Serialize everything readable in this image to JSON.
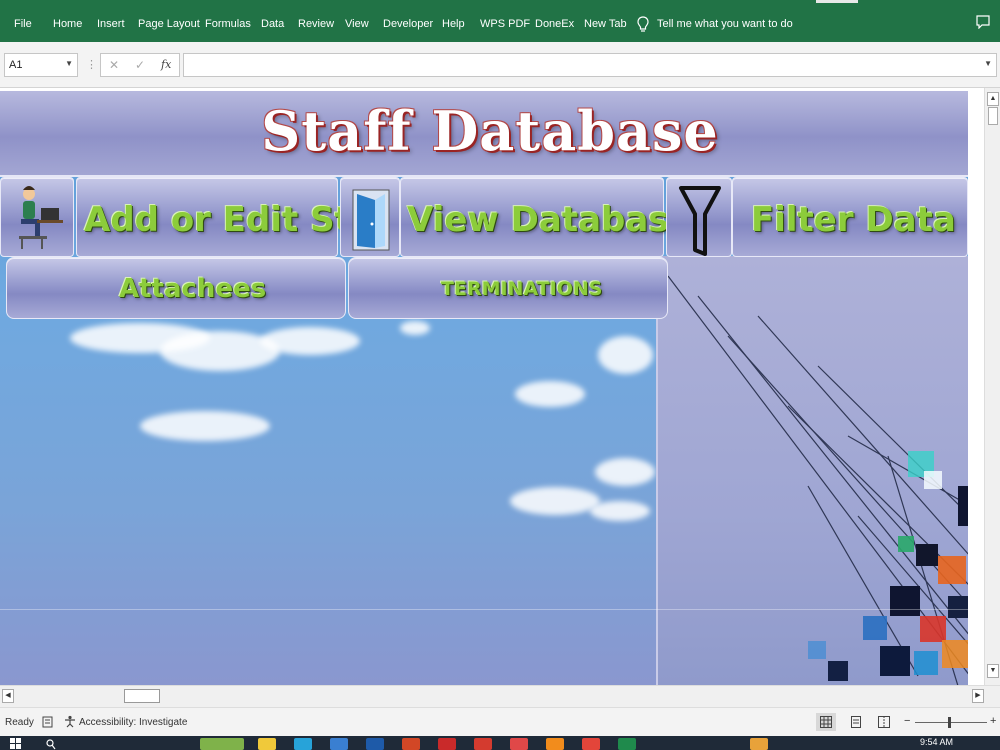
{
  "ribbon": {
    "tabs": [
      "File",
      "Home",
      "Insert",
      "Page Layout",
      "Formulas",
      "Data",
      "Review",
      "View",
      "Developer",
      "Help",
      "WPS PDF",
      "DoneEx",
      "New Tab"
    ],
    "tell_me": "Tell me what you want to do"
  },
  "formula_bar": {
    "name_box": "A1",
    "cancel_glyph": "✕",
    "enter_glyph": "✓",
    "fx_glyph": "fx",
    "formula_value": ""
  },
  "dashboard": {
    "title": "Staff Database",
    "buttons": {
      "add_edit_staff": "Add or Edit Staff",
      "view_database": "View   Database",
      "filter_data": "Filter Data",
      "attachees": "Attachees",
      "terminations": "TERMINATIONS"
    }
  },
  "status": {
    "ready": "Ready",
    "accessibility": "Accessibility: Investigate",
    "zoom_minus": "−",
    "zoom_plus": "+"
  },
  "taskbar": {
    "time": "9:54 AM"
  },
  "colors": {
    "ribbon": "#217346",
    "label_green": "#8ccc3b",
    "title_outline": "#9a2424"
  }
}
